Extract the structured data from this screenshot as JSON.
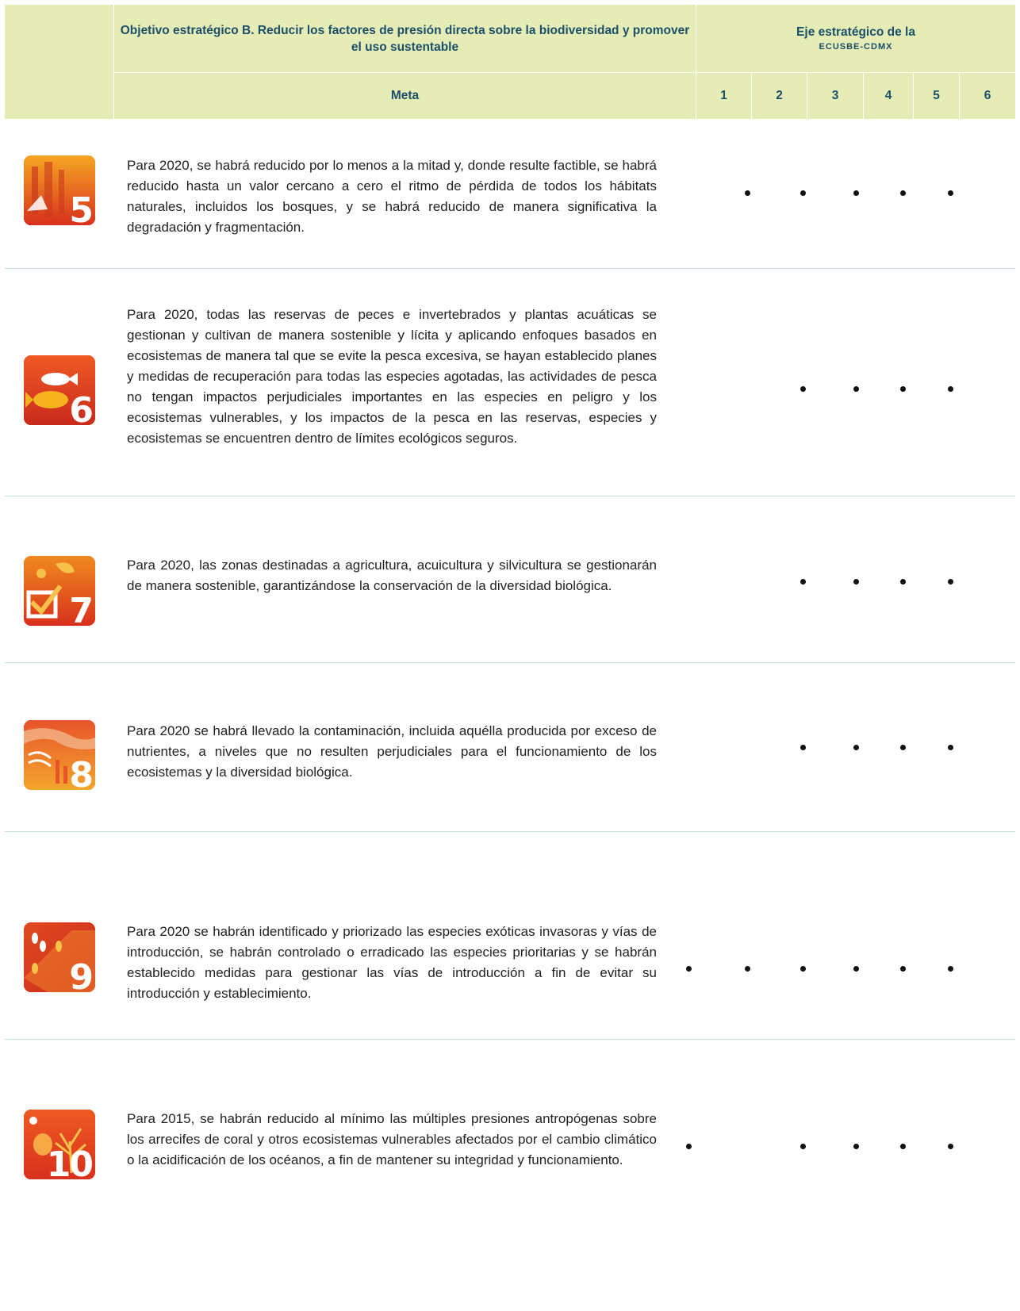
{
  "header": {
    "objective": "Objetivo estratégico B. Reducir los factores de presión directa sobre la biodiversidad y promover el uso sustentable",
    "eje_line1": "Eje estratégico de la",
    "eje_line2": "ECUSBE-CDMX",
    "meta_label": "Meta",
    "axes": [
      "1",
      "2",
      "3",
      "4",
      "5",
      "6"
    ]
  },
  "colors": {
    "header_bg": "#e5ecb6",
    "header_text": "#1b4f6a",
    "divider": "#cfe0e4"
  },
  "rows": [
    {
      "icon": "forest-habitat-icon",
      "number": "5",
      "text": "Para 2020, se habrá reducido por lo menos a la mitad y, donde resulte factible, se habrá reducido hasta un valor cercano a cero el ritmo de pérdida de todos los hábitats naturales, incluidos los bosques, y se habrá reducido de manera significativa la degradación y fragmentación.",
      "marks": [
        false,
        true,
        true,
        true,
        true,
        true
      ]
    },
    {
      "icon": "fish-icon",
      "number": "6",
      "text": "Para 2020, todas las reservas de peces e invertebrados y plantas acuáticas se gestionan y cultivan de manera sostenible y lícita y aplicando enfoques basados en ecosistemas de manera tal que se evite la pesca excesiva, se hayan establecido planes y medidas de recuperación para todas las especies agotadas, las actividades de pesca no tengan impactos perjudiciales importantes en las especies en peligro y los ecosistemas vulnerables, y los impactos de la pesca en las reservas, especies y ecosistemas se encuentren dentro de límites ecológicos seguros.",
      "marks": [
        false,
        false,
        true,
        true,
        true,
        true
      ]
    },
    {
      "icon": "agriculture-check-icon",
      "number": "7",
      "text": "Para 2020, las zonas destinadas a agricultura, acuicultura y silvicultura se gestionarán de manera sostenible, garantizándose la conservación de la diversidad biológica.",
      "marks": [
        false,
        false,
        true,
        true,
        true,
        true
      ]
    },
    {
      "icon": "pollution-icon",
      "number": "8",
      "text": "Para 2020 se habrá llevado la contaminación, incluida aquélla producida por exceso de nutrientes, a niveles que no resulten perjudiciales para el funcionamiento de los ecosistemas y la diversidad biológica.",
      "marks": [
        false,
        false,
        true,
        true,
        true,
        true
      ]
    },
    {
      "icon": "footprints-icon",
      "number": "9",
      "text": "Para 2020 se habrán identificado y priorizado las especies exóticas invasoras y vías de introducción, se habrán controlado o erradicado las especies prioritarias y se habrán establecido medidas para gestionar las vías de introducción a fin de evitar su introducción y establecimiento.",
      "marks": [
        true,
        true,
        true,
        true,
        true,
        true
      ]
    },
    {
      "icon": "coral-reef-icon",
      "number": "10",
      "text": "Para 2015, se habrán reducido al mínimo las múltiples presiones antropógenas sobre los arrecifes de coral y otros ecosistemas vulnerables afectados por el cambio climático o la acidificación de los océanos, a fin de mantener su integridad y funcionamiento.",
      "marks": [
        true,
        false,
        true,
        true,
        true,
        true
      ]
    }
  ]
}
